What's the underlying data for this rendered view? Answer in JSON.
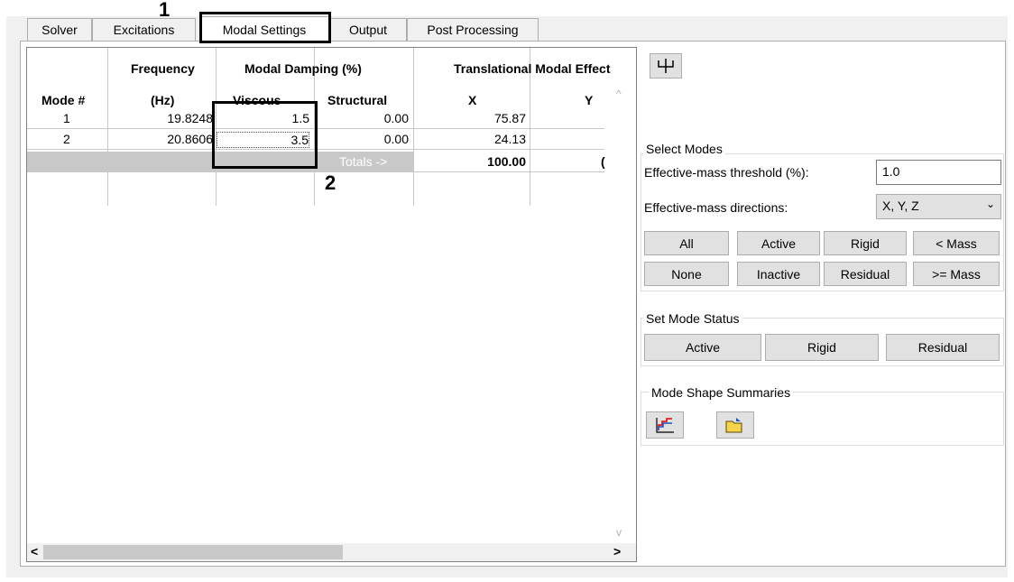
{
  "tabs": [
    {
      "label": "Solver"
    },
    {
      "label": "Excitations"
    },
    {
      "label": "Modal Settings"
    },
    {
      "label": "Output"
    },
    {
      "label": "Post Processing"
    }
  ],
  "callouts": {
    "one": "1",
    "two": "2"
  },
  "table": {
    "group_headers": {
      "frequency": "Frequency",
      "damping": "Modal Damping (%)",
      "translational": "Translational Modal Effect"
    },
    "col_headers": {
      "mode": "Mode #",
      "hz": "(Hz)",
      "viscous": "Viscous",
      "structural": "Structural",
      "x": "X",
      "y": "Y"
    },
    "rows": [
      {
        "mode": "1",
        "freq": "19.8248",
        "viscous": "1.5",
        "structural": "0.00",
        "x": "75.87",
        "y": ""
      },
      {
        "mode": "2",
        "freq": "20.8606",
        "viscous": "3.5",
        "structural": "0.00",
        "x": "24.13",
        "y": ""
      }
    ],
    "totals": {
      "label": "Totals ->",
      "x": "100.00",
      "y": "("
    }
  },
  "right": {
    "select_modes": {
      "title": "Select Modes",
      "threshold_label": "Effective-mass threshold (%):",
      "threshold_value": "1.0",
      "directions_label": "Effective-mass directions:",
      "directions_value": "X, Y, Z",
      "buttons": {
        "all": "All",
        "active": "Active",
        "rigid": "Rigid",
        "lt_mass": "< Mass",
        "none": "None",
        "inactive": "Inactive",
        "residual": "Residual",
        "ge_mass": ">= Mass"
      }
    },
    "set_mode_status": {
      "title": "Set Mode Status",
      "active": "Active",
      "rigid": "Rigid",
      "residual": "Residual"
    },
    "mode_shape": {
      "title": "Mode Shape Summaries"
    }
  },
  "icons": {
    "split": "split-view-icon",
    "chart": "chart-icon",
    "folder": "open-folder-icon"
  }
}
